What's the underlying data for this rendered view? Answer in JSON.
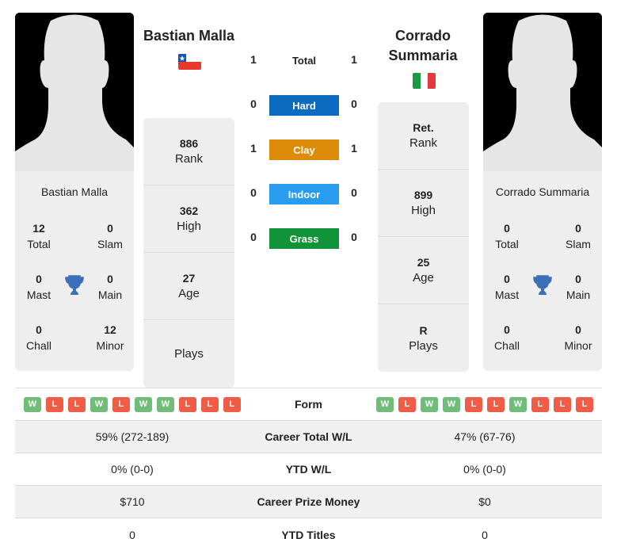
{
  "colors": {
    "hard": "#0b6bbf",
    "clay": "#dc8c0a",
    "indoor": "#2a9cf0",
    "grass": "#119339",
    "win": "#6fbd79",
    "loss": "#ef5d47",
    "trophy": "#3c6fb9"
  },
  "player1": {
    "name": "Bastian Malla",
    "country": "Chile",
    "titles": [
      {
        "value": "12",
        "label": "Total"
      },
      {
        "value": "0",
        "label": "Slam"
      },
      {
        "value": "0",
        "label": "Mast"
      },
      {
        "value": "0",
        "label": "Main"
      },
      {
        "value": "0",
        "label": "Chall"
      },
      {
        "value": "12",
        "label": "Minor"
      }
    ],
    "rank": [
      {
        "value": "886",
        "label": "Rank"
      },
      {
        "value": "362",
        "label": "High"
      },
      {
        "value": "27",
        "label": "Age"
      },
      {
        "value": "",
        "label": "Plays"
      }
    ],
    "form": [
      "W",
      "L",
      "L",
      "W",
      "L",
      "W",
      "W",
      "L",
      "L",
      "L"
    ]
  },
  "player2": {
    "name": "Corrado Summaria",
    "country": "Italy",
    "titles": [
      {
        "value": "0",
        "label": "Total"
      },
      {
        "value": "0",
        "label": "Slam"
      },
      {
        "value": "0",
        "label": "Mast"
      },
      {
        "value": "0",
        "label": "Main"
      },
      {
        "value": "0",
        "label": "Chall"
      },
      {
        "value": "0",
        "label": "Minor"
      }
    ],
    "rank": [
      {
        "value": "Ret.",
        "label": "Rank"
      },
      {
        "value": "899",
        "label": "High"
      },
      {
        "value": "25",
        "label": "Age"
      },
      {
        "value": "R",
        "label": "Plays"
      }
    ],
    "form": [
      "W",
      "L",
      "W",
      "W",
      "L",
      "L",
      "W",
      "L",
      "L",
      "L"
    ]
  },
  "h2h": {
    "total": {
      "label": "Total",
      "p1": "1",
      "p2": "1"
    },
    "surfaces": [
      {
        "label": "Hard",
        "p1": "0",
        "p2": "0"
      },
      {
        "label": "Clay",
        "p1": "1",
        "p2": "1"
      },
      {
        "label": "Indoor",
        "p1": "0",
        "p2": "0"
      },
      {
        "label": "Grass",
        "p1": "0",
        "p2": "0"
      }
    ]
  },
  "comparison": {
    "form_label": "Form",
    "rows": [
      {
        "label": "Career Total W/L",
        "p1": "59% (272-189)",
        "p2": "47% (67-76)"
      },
      {
        "label": "YTD W/L",
        "p1": "0% (0-0)",
        "p2": "0% (0-0)"
      },
      {
        "label": "Career Prize Money",
        "p1": "$710",
        "p2": "$0"
      },
      {
        "label": "YTD Titles",
        "p1": "0",
        "p2": "0"
      }
    ]
  }
}
